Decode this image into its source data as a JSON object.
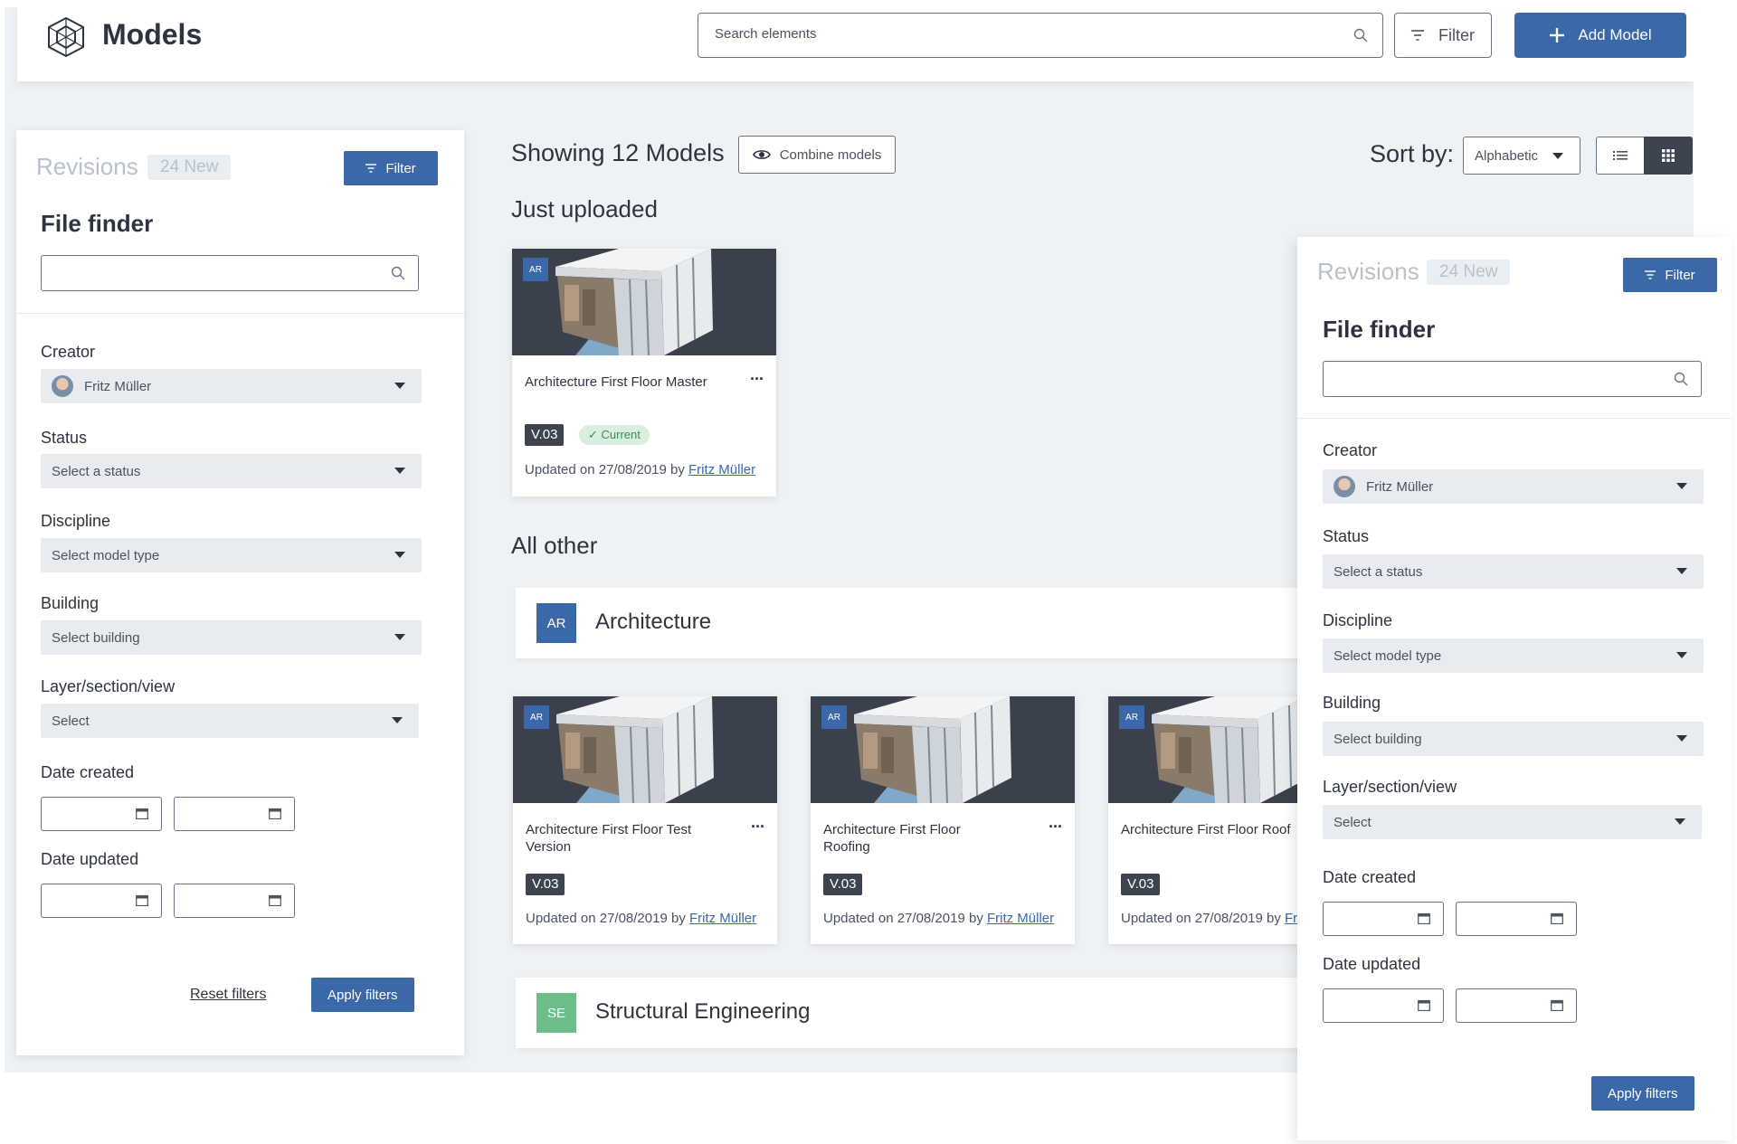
{
  "header": {
    "title": "Models",
    "search_placeholder": "Search elements",
    "filter_label": "Filter",
    "add_model_label": "Add Model"
  },
  "panel_left": {
    "revisions_label": "Revisions",
    "new_badge": "24 New",
    "filter_label": "Filter",
    "file_finder_title": "File finder",
    "creator_label": "Creator",
    "creator_value": "Fritz Müller",
    "status_label": "Status",
    "status_value": "Select a status",
    "discipline_label": "Discipline",
    "discipline_value": "Select model type",
    "building_label": "Building",
    "building_value": "Select building",
    "layer_label": "Layer/section/view",
    "layer_value": "Select",
    "date_created_label": "Date created",
    "date_updated_label": "Date updated",
    "reset_label": "Reset filters",
    "apply_label": "Apply filters"
  },
  "panel_right": {
    "revisions_label": "Revisions",
    "new_badge": "24 New",
    "filter_label": "Filter",
    "file_finder_title": "File finder",
    "creator_label": "Creator",
    "creator_value": "Fritz Müller",
    "status_label": "Status",
    "status_value": "Select a status",
    "discipline_label": "Discipline",
    "discipline_value": "Select model type",
    "building_label": "Building",
    "building_value": "Select building",
    "layer_label": "Layer/section/view",
    "layer_value": "Select",
    "date_created_label": "Date created",
    "date_updated_label": "Date updated",
    "apply_label": "Apply filters"
  },
  "main": {
    "showing": "Showing 12 Models",
    "combine_label": "Combine models",
    "sort_label": "Sort by:",
    "sort_value": "Alphabetic",
    "just_uploaded": "Just uploaded",
    "all_other": "All other",
    "groups": [
      {
        "badge": "AR",
        "name": "Architecture",
        "color": "#3a68a8"
      },
      {
        "badge": "SE",
        "name": "Structural Engineering",
        "color": "#6cbf8a"
      }
    ],
    "cards": [
      {
        "tag": "AR",
        "title": "Architecture First Floor Master",
        "more": "···",
        "version": "V.03",
        "status": "Current",
        "updated": "Updated on 27/08/2019 by ",
        "author": "Fritz Müller"
      },
      {
        "tag": "AR",
        "title": "Architecture First Floor Test Version",
        "more": "···",
        "version": "V.03",
        "updated": "Updated on 27/08/2019 by ",
        "author": "Fritz Müller"
      },
      {
        "tag": "AR",
        "title": "Architecture First Floor Roofing",
        "more": "···",
        "version": "V.03",
        "updated": "Updated on 27/08/2019 by ",
        "author": "Fritz Müller"
      },
      {
        "tag": "AR",
        "title": "Architecture First Floor Roof",
        "version": "V.03",
        "updated": "Updated on 27/08/2019 by ",
        "author": "Fr"
      }
    ]
  }
}
